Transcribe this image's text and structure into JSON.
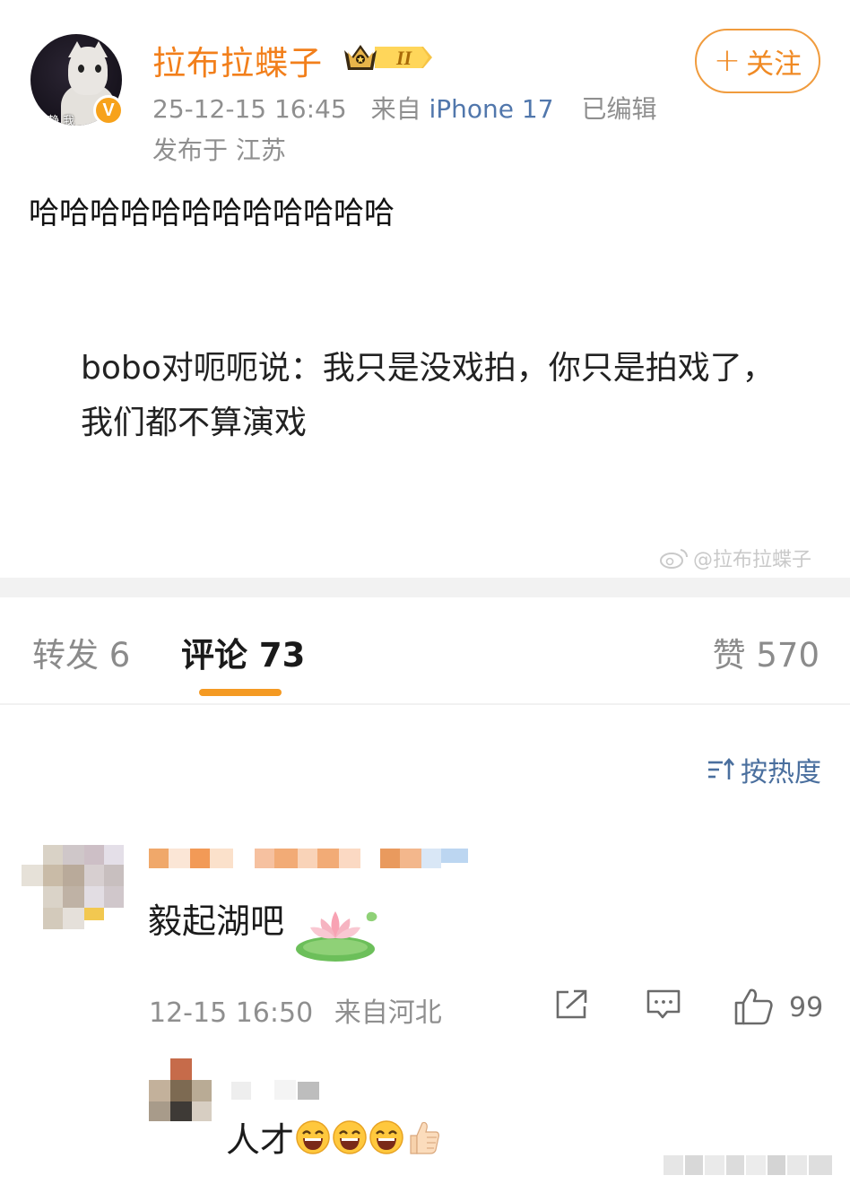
{
  "post": {
    "username": "拉布拉蝶子",
    "member_badge": "II",
    "timestamp": "25-12-15 16:45",
    "source_prefix": "来自",
    "device": "iPhone 17",
    "edited": "已编辑",
    "location": "发布于 江苏",
    "follow_label": "关注",
    "follow_plus": "+",
    "avatar_text": "安静 我",
    "verified_badge": "V",
    "text_line1": "哈哈哈哈哈哈哈哈哈哈哈哈",
    "quote": "bobo对呃呃说：我只是没戏拍，你只是拍戏了，我们都不算演戏",
    "watermark": "@拉布拉蝶子"
  },
  "tabs": {
    "repost": "转发 6",
    "comments": "评论 73",
    "likes": "赞 570"
  },
  "sort": {
    "label": "按热度",
    "icon": "sort-icon"
  },
  "comments": [
    {
      "text": "毅起湖吧",
      "time": "12-15 16:50",
      "location": "来自河北",
      "like_count": "99",
      "reply": {
        "text": "人才"
      }
    }
  ],
  "colors": {
    "username": "#f27f1b",
    "accent": "#f49a23",
    "link": "#5177ac",
    "meta": "#8f8f8f"
  }
}
